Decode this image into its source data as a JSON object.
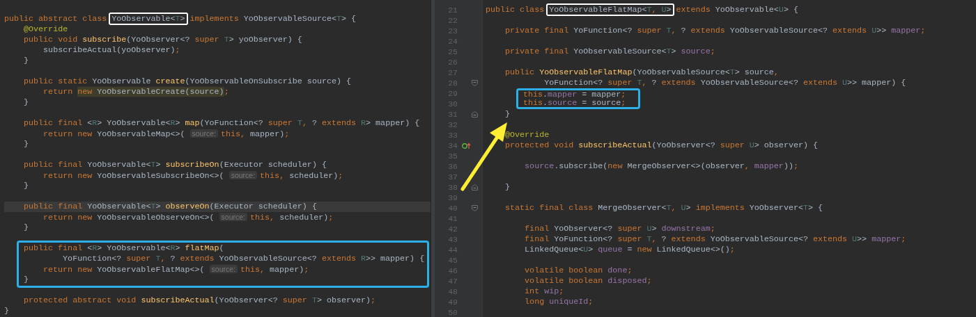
{
  "left_editor": {
    "lines": [
      {
        "kind": "blank"
      },
      {
        "kind": "line",
        "tokens": [
          {
            "kind": "keyword",
            "text": "public abstract class "
          },
          {
            "kind": "frame",
            "tokens": [
              {
                "kind": "plain",
                "text": "YoObservable<"
              },
              {
                "kind": "generic",
                "text": "T"
              },
              {
                "kind": "plain",
                "text": ">"
              }
            ]
          },
          {
            "kind": "keyword",
            "text": " implements "
          },
          {
            "kind": "plain",
            "text": "YoObservableSource<"
          },
          {
            "kind": "generic",
            "text": "T"
          },
          {
            "kind": "plain",
            "text": "> {"
          }
        ]
      },
      {
        "kind": "line",
        "tokens": [
          {
            "kind": "annotation",
            "text": "    @Override"
          }
        ]
      },
      {
        "kind": "line",
        "tokens": [
          {
            "kind": "keyword",
            "text": "    public void "
          },
          {
            "kind": "method",
            "text": "subscribe"
          },
          {
            "kind": "plain",
            "text": "(YoObserver<? "
          },
          {
            "kind": "keyword",
            "text": "super "
          },
          {
            "kind": "generic",
            "text": "T"
          },
          {
            "kind": "plain",
            "text": "> yoObserver) {"
          }
        ]
      },
      {
        "kind": "line",
        "tokens": [
          {
            "kind": "plain",
            "text": "        subscribeActual(yoObserver)"
          },
          {
            "kind": "keyword",
            "text": ";"
          }
        ]
      },
      {
        "kind": "line",
        "tokens": [
          {
            "kind": "plain",
            "text": "    }"
          }
        ]
      },
      {
        "kind": "blank"
      },
      {
        "kind": "line",
        "tokens": [
          {
            "kind": "keyword",
            "text": "    public static "
          },
          {
            "kind": "plain",
            "text": "YoObservable "
          },
          {
            "kind": "method",
            "text": "create"
          },
          {
            "kind": "plain",
            "text": "(YoObservableOnSubscribe source) {"
          }
        ]
      },
      {
        "kind": "line",
        "tokens": [
          {
            "kind": "keyword",
            "text": "        return "
          },
          {
            "kind": "match",
            "tokens": [
              {
                "kind": "keyword",
                "text": "new "
              },
              {
                "kind": "plain",
                "text": "YoObservableCreate(source)"
              }
            ]
          },
          {
            "kind": "keyword",
            "text": ";"
          }
        ]
      },
      {
        "kind": "line",
        "tokens": [
          {
            "kind": "plain",
            "text": "    }"
          }
        ]
      },
      {
        "kind": "blank"
      },
      {
        "kind": "line",
        "tokens": [
          {
            "kind": "keyword",
            "text": "    public final "
          },
          {
            "kind": "plain",
            "text": "<"
          },
          {
            "kind": "generic",
            "text": "R"
          },
          {
            "kind": "plain",
            "text": "> YoObservable<"
          },
          {
            "kind": "generic",
            "text": "R"
          },
          {
            "kind": "plain",
            "text": "> "
          },
          {
            "kind": "method",
            "text": "map"
          },
          {
            "kind": "plain",
            "text": "(YoFunction<? "
          },
          {
            "kind": "keyword",
            "text": "super "
          },
          {
            "kind": "generic",
            "text": "T"
          },
          {
            "kind": "keyword",
            "text": ", "
          },
          {
            "kind": "plain",
            "text": "? "
          },
          {
            "kind": "keyword",
            "text": "extends "
          },
          {
            "kind": "generic",
            "text": "R"
          },
          {
            "kind": "plain",
            "text": "> mapper) {"
          }
        ]
      },
      {
        "kind": "line",
        "tokens": [
          {
            "kind": "keyword",
            "text": "        return new "
          },
          {
            "kind": "plain",
            "text": "YoObservableMap<>( "
          },
          {
            "kind": "hint",
            "text": "source:"
          },
          {
            "kind": "keyword",
            "text": "this, "
          },
          {
            "kind": "plain",
            "text": "mapper)"
          },
          {
            "kind": "keyword",
            "text": ";"
          }
        ]
      },
      {
        "kind": "line",
        "tokens": [
          {
            "kind": "plain",
            "text": "    }"
          }
        ]
      },
      {
        "kind": "blank"
      },
      {
        "kind": "line",
        "tokens": [
          {
            "kind": "keyword",
            "text": "    public final "
          },
          {
            "kind": "plain",
            "text": "YoObservable<"
          },
          {
            "kind": "generic",
            "text": "T"
          },
          {
            "kind": "plain",
            "text": "> "
          },
          {
            "kind": "method",
            "text": "subscribeOn"
          },
          {
            "kind": "plain",
            "text": "(Executor scheduler) {"
          }
        ]
      },
      {
        "kind": "line",
        "tokens": [
          {
            "kind": "keyword",
            "text": "        return new "
          },
          {
            "kind": "plain",
            "text": "YoObservableSubscribeOn<>( "
          },
          {
            "kind": "hint",
            "text": "source:"
          },
          {
            "kind": "keyword",
            "text": "this, "
          },
          {
            "kind": "plain",
            "text": "scheduler)"
          },
          {
            "kind": "keyword",
            "text": ";"
          }
        ]
      },
      {
        "kind": "line",
        "tokens": [
          {
            "kind": "plain",
            "text": "    }"
          }
        ]
      },
      {
        "kind": "blank"
      },
      {
        "kind": "line",
        "current": true,
        "tokens": [
          {
            "kind": "keyword",
            "text": "    public final "
          },
          {
            "kind": "plain",
            "text": "YoObservable<"
          },
          {
            "kind": "generic",
            "text": "T"
          },
          {
            "kind": "plain",
            "text": "> "
          },
          {
            "kind": "method",
            "text": "observeOn"
          },
          {
            "kind": "plain",
            "text": "(Executor scheduler) {"
          }
        ]
      },
      {
        "kind": "line",
        "tokens": [
          {
            "kind": "keyword",
            "text": "        return new "
          },
          {
            "kind": "plain",
            "text": "YoObservableObserveOn<>( "
          },
          {
            "kind": "hint",
            "text": "source:"
          },
          {
            "kind": "keyword",
            "text": "this, "
          },
          {
            "kind": "plain",
            "text": "scheduler)"
          },
          {
            "kind": "keyword",
            "text": ";"
          }
        ]
      },
      {
        "kind": "line",
        "tokens": [
          {
            "kind": "plain",
            "text": "    }"
          }
        ]
      },
      {
        "kind": "blank"
      },
      {
        "kind": "frame",
        "lines": [
          {
            "kind": "line",
            "tokens": [
              {
                "kind": "keyword",
                "text": "public final "
              },
              {
                "kind": "plain",
                "text": "<"
              },
              {
                "kind": "generic",
                "text": "R"
              },
              {
                "kind": "plain",
                "text": "> YoObservable<"
              },
              {
                "kind": "generic",
                "text": "R"
              },
              {
                "kind": "plain",
                "text": "> "
              },
              {
                "kind": "method",
                "text": "flatMap"
              },
              {
                "kind": "plain",
                "text": "("
              }
            ]
          },
          {
            "kind": "line",
            "tokens": [
              {
                "kind": "plain",
                "text": "        YoFunction<? "
              },
              {
                "kind": "keyword",
                "text": "super "
              },
              {
                "kind": "generic",
                "text": "T"
              },
              {
                "kind": "keyword",
                "text": ", "
              },
              {
                "kind": "plain",
                "text": "? "
              },
              {
                "kind": "keyword",
                "text": "extends "
              },
              {
                "kind": "plain",
                "text": "YoObservableSource<? "
              },
              {
                "kind": "keyword",
                "text": "extends "
              },
              {
                "kind": "generic",
                "text": "R"
              },
              {
                "kind": "plain",
                "text": ">> mapper) {"
              }
            ]
          },
          {
            "kind": "line",
            "tokens": [
              {
                "kind": "keyword",
                "text": "    return new "
              },
              {
                "kind": "plain",
                "text": "YoObservableFlatMap<>( "
              },
              {
                "kind": "hint",
                "text": "source:"
              },
              {
                "kind": "keyword",
                "text": "this, "
              },
              {
                "kind": "plain",
                "text": "mapper)"
              },
              {
                "kind": "keyword",
                "text": ";"
              }
            ]
          },
          {
            "kind": "line",
            "tokens": [
              {
                "kind": "plain",
                "text": "}"
              }
            ]
          }
        ]
      },
      {
        "kind": "blank"
      },
      {
        "kind": "line",
        "tokens": [
          {
            "kind": "keyword",
            "text": "    protected abstract void "
          },
          {
            "kind": "method",
            "text": "subscribeActual"
          },
          {
            "kind": "plain",
            "text": "(YoObserver<? "
          },
          {
            "kind": "keyword",
            "text": "super "
          },
          {
            "kind": "generic",
            "text": "T"
          },
          {
            "kind": "plain",
            "text": "> observer)"
          },
          {
            "kind": "keyword",
            "text": ";"
          }
        ]
      },
      {
        "kind": "line",
        "tokens": [
          {
            "kind": "plain",
            "text": "}"
          }
        ]
      }
    ]
  },
  "right_editor": {
    "gutter": [
      {
        "number": "21",
        "kind": "plain"
      },
      {
        "number": "22",
        "kind": "plain"
      },
      {
        "number": "23",
        "kind": "plain"
      },
      {
        "number": "24",
        "kind": "plain"
      },
      {
        "number": "25",
        "kind": "plain"
      },
      {
        "number": "26",
        "kind": "plain"
      },
      {
        "number": "27",
        "kind": "plain"
      },
      {
        "number": "28",
        "kind": "fold-start"
      },
      {
        "number": "29",
        "kind": "plain"
      },
      {
        "number": "30",
        "kind": "plain"
      },
      {
        "number": "31",
        "kind": "fold-end"
      },
      {
        "number": "32",
        "kind": "plain"
      },
      {
        "number": "33",
        "kind": "plain"
      },
      {
        "number": "34",
        "kind": "override"
      },
      {
        "number": "35",
        "kind": "plain"
      },
      {
        "number": "36",
        "kind": "plain"
      },
      {
        "number": "37",
        "kind": "plain"
      },
      {
        "number": "38",
        "kind": "fold-end"
      },
      {
        "number": "39",
        "kind": "plain"
      },
      {
        "number": "40",
        "kind": "fold-start"
      },
      {
        "number": "41",
        "kind": "plain"
      },
      {
        "number": "42",
        "kind": "plain"
      },
      {
        "number": "43",
        "kind": "plain"
      },
      {
        "number": "44",
        "kind": "plain"
      },
      {
        "number": "45",
        "kind": "plain"
      },
      {
        "number": "46",
        "kind": "plain"
      },
      {
        "number": "47",
        "kind": "plain"
      },
      {
        "number": "48",
        "kind": "plain"
      },
      {
        "number": "49",
        "kind": "plain"
      },
      {
        "number": "50",
        "kind": "plain"
      }
    ],
    "lines": [
      {
        "kind": "line",
        "tokens": [
          {
            "kind": "keyword",
            "text": "public class "
          },
          {
            "kind": "frame",
            "tokens": [
              {
                "kind": "plain",
                "text": "YoObservableFlatMap<"
              },
              {
                "kind": "generic",
                "text": "T"
              },
              {
                "kind": "keyword",
                "text": ", "
              },
              {
                "kind": "generic",
                "text": "U"
              },
              {
                "kind": "plain",
                "text": ">"
              }
            ]
          },
          {
            "kind": "keyword",
            "text": " extends "
          },
          {
            "kind": "plain",
            "text": "YoObservable<"
          },
          {
            "kind": "generic",
            "text": "U"
          },
          {
            "kind": "plain",
            "text": "> {"
          }
        ]
      },
      {
        "kind": "blank"
      },
      {
        "kind": "line",
        "tokens": [
          {
            "kind": "keyword",
            "text": "    private final "
          },
          {
            "kind": "plain",
            "text": "YoFunction<? "
          },
          {
            "kind": "keyword",
            "text": "super "
          },
          {
            "kind": "generic",
            "text": "T"
          },
          {
            "kind": "keyword",
            "text": ", "
          },
          {
            "kind": "plain",
            "text": "? "
          },
          {
            "kind": "keyword",
            "text": "extends "
          },
          {
            "kind": "plain",
            "text": "YoObservableSource<? "
          },
          {
            "kind": "keyword",
            "text": "extends "
          },
          {
            "kind": "generic",
            "text": "U"
          },
          {
            "kind": "plain",
            "text": ">> "
          },
          {
            "kind": "field",
            "text": "mapper"
          },
          {
            "kind": "keyword",
            "text": ";"
          }
        ]
      },
      {
        "kind": "blank"
      },
      {
        "kind": "line",
        "tokens": [
          {
            "kind": "keyword",
            "text": "    private final "
          },
          {
            "kind": "plain",
            "text": "YoObservableSource<"
          },
          {
            "kind": "generic",
            "text": "T"
          },
          {
            "kind": "plain",
            "text": "> "
          },
          {
            "kind": "field",
            "text": "source"
          },
          {
            "kind": "keyword",
            "text": ";"
          }
        ]
      },
      {
        "kind": "blank"
      },
      {
        "kind": "line",
        "tokens": [
          {
            "kind": "keyword",
            "text": "    public "
          },
          {
            "kind": "method",
            "text": "YoObservableFlatMap"
          },
          {
            "kind": "plain",
            "text": "(YoObservableSource<"
          },
          {
            "kind": "generic",
            "text": "T"
          },
          {
            "kind": "plain",
            "text": "> source"
          },
          {
            "kind": "keyword",
            "text": ","
          }
        ]
      },
      {
        "kind": "line",
        "tokens": [
          {
            "kind": "plain",
            "text": "            YoFunction<? "
          },
          {
            "kind": "keyword",
            "text": "super "
          },
          {
            "kind": "generic",
            "text": "T"
          },
          {
            "kind": "keyword",
            "text": ", "
          },
          {
            "kind": "plain",
            "text": "? "
          },
          {
            "kind": "keyword",
            "text": "extends "
          },
          {
            "kind": "plain",
            "text": "YoObservableSource<? "
          },
          {
            "kind": "keyword",
            "text": "extends "
          },
          {
            "kind": "generic",
            "text": "U"
          },
          {
            "kind": "plain",
            "text": ">> mapper) {"
          }
        ]
      },
      {
        "kind": "frame",
        "lines": [
          {
            "kind": "line",
            "tokens": [
              {
                "kind": "keyword",
                "text": "this"
              },
              {
                "kind": "plain",
                "text": "."
              },
              {
                "kind": "field",
                "text": "mapper"
              },
              {
                "kind": "plain",
                "text": " = mapper"
              },
              {
                "kind": "keyword",
                "text": ";"
              }
            ]
          },
          {
            "kind": "line",
            "tokens": [
              {
                "kind": "keyword",
                "text": "this"
              },
              {
                "kind": "plain",
                "text": "."
              },
              {
                "kind": "field",
                "text": "source"
              },
              {
                "kind": "plain",
                "text": " = source"
              },
              {
                "kind": "keyword",
                "text": ";"
              }
            ]
          }
        ]
      },
      {
        "kind": "line",
        "tokens": [
          {
            "kind": "plain",
            "text": "    }"
          }
        ]
      },
      {
        "kind": "blank"
      },
      {
        "kind": "line",
        "tokens": [
          {
            "kind": "annotation",
            "text": "    @Override"
          }
        ]
      },
      {
        "kind": "line",
        "tokens": [
          {
            "kind": "keyword",
            "text": "    protected void "
          },
          {
            "kind": "method",
            "text": "subscribeActual"
          },
          {
            "kind": "plain",
            "text": "(YoObserver<? "
          },
          {
            "kind": "keyword",
            "text": "super "
          },
          {
            "kind": "generic",
            "text": "U"
          },
          {
            "kind": "plain",
            "text": "> observer) {"
          }
        ]
      },
      {
        "kind": "blank"
      },
      {
        "kind": "line",
        "tokens": [
          {
            "kind": "field",
            "text": "        source"
          },
          {
            "kind": "plain",
            "text": ".subscribe("
          },
          {
            "kind": "keyword",
            "text": "new "
          },
          {
            "kind": "plain",
            "text": "MergeObserver<>(observer"
          },
          {
            "kind": "keyword",
            "text": ", "
          },
          {
            "kind": "field",
            "text": "mapper"
          },
          {
            "kind": "plain",
            "text": "))"
          },
          {
            "kind": "keyword",
            "text": ";"
          }
        ]
      },
      {
        "kind": "blank"
      },
      {
        "kind": "line",
        "tokens": [
          {
            "kind": "plain",
            "text": "    }"
          }
        ]
      },
      {
        "kind": "blank"
      },
      {
        "kind": "line",
        "tokens": [
          {
            "kind": "keyword",
            "text": "    static final class "
          },
          {
            "kind": "plain",
            "text": "MergeObserver<"
          },
          {
            "kind": "generic",
            "text": "T"
          },
          {
            "kind": "keyword",
            "text": ", "
          },
          {
            "kind": "generic",
            "text": "U"
          },
          {
            "kind": "plain",
            "text": "> "
          },
          {
            "kind": "keyword",
            "text": "implements "
          },
          {
            "kind": "plain",
            "text": "YoObserver<"
          },
          {
            "kind": "generic",
            "text": "T"
          },
          {
            "kind": "plain",
            "text": "> {"
          }
        ]
      },
      {
        "kind": "blank"
      },
      {
        "kind": "line",
        "tokens": [
          {
            "kind": "keyword",
            "text": "        final "
          },
          {
            "kind": "plain",
            "text": "YoObserver<? "
          },
          {
            "kind": "keyword",
            "text": "super "
          },
          {
            "kind": "generic",
            "text": "U"
          },
          {
            "kind": "plain",
            "text": "> "
          },
          {
            "kind": "field",
            "text": "downstream"
          },
          {
            "kind": "keyword",
            "text": ";"
          }
        ]
      },
      {
        "kind": "line",
        "tokens": [
          {
            "kind": "keyword",
            "text": "        final "
          },
          {
            "kind": "plain",
            "text": "YoFunction<? "
          },
          {
            "kind": "keyword",
            "text": "super "
          },
          {
            "kind": "generic",
            "text": "T"
          },
          {
            "kind": "keyword",
            "text": ", "
          },
          {
            "kind": "plain",
            "text": "? "
          },
          {
            "kind": "keyword",
            "text": "extends "
          },
          {
            "kind": "plain",
            "text": "YoObservableSource<? "
          },
          {
            "kind": "keyword",
            "text": "extends "
          },
          {
            "kind": "generic",
            "text": "U"
          },
          {
            "kind": "plain",
            "text": ">> "
          },
          {
            "kind": "field",
            "text": "mapper"
          },
          {
            "kind": "keyword",
            "text": ";"
          }
        ]
      },
      {
        "kind": "line",
        "tokens": [
          {
            "kind": "plain",
            "text": "        LinkedQueue<"
          },
          {
            "kind": "generic",
            "text": "U"
          },
          {
            "kind": "plain",
            "text": "> "
          },
          {
            "kind": "field",
            "text": "queue"
          },
          {
            "kind": "plain",
            "text": " = "
          },
          {
            "kind": "keyword",
            "text": "new "
          },
          {
            "kind": "plain",
            "text": "LinkedQueue<>()"
          },
          {
            "kind": "keyword",
            "text": ";"
          }
        ]
      },
      {
        "kind": "blank"
      },
      {
        "kind": "line",
        "tokens": [
          {
            "kind": "keyword",
            "text": "        volatile boolean "
          },
          {
            "kind": "field",
            "text": "done"
          },
          {
            "kind": "keyword",
            "text": ";"
          }
        ]
      },
      {
        "kind": "line",
        "tokens": [
          {
            "kind": "keyword",
            "text": "        volatile boolean "
          },
          {
            "kind": "field",
            "text": "disposed"
          },
          {
            "kind": "keyword",
            "text": ";"
          }
        ]
      },
      {
        "kind": "line",
        "tokens": [
          {
            "kind": "keyword",
            "text": "        int "
          },
          {
            "kind": "field",
            "text": "wip"
          },
          {
            "kind": "keyword",
            "text": ";"
          }
        ]
      },
      {
        "kind": "line",
        "tokens": [
          {
            "kind": "keyword",
            "text": "        long "
          },
          {
            "kind": "field",
            "text": "uniqueId"
          },
          {
            "kind": "keyword",
            "text": ";"
          }
        ]
      },
      {
        "kind": "blank"
      }
    ]
  }
}
